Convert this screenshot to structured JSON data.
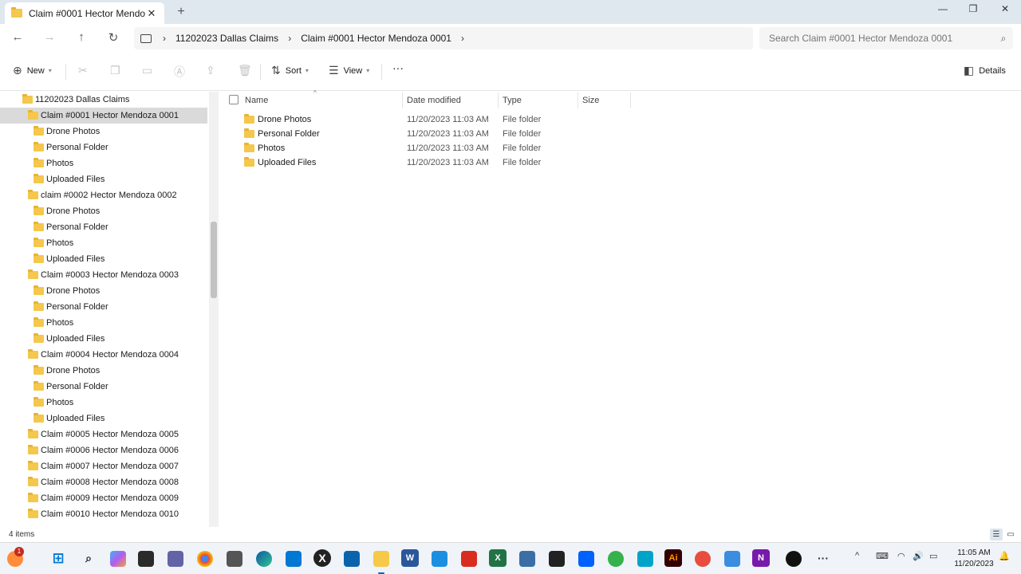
{
  "window": {
    "tab_title": "Claim #0001 Hector Mendoza 0001",
    "tab_close": "✕",
    "new_tab": "+",
    "minimize": "—",
    "maximize": "❐",
    "close": "✕"
  },
  "address": {
    "crumbs": [
      "11202023 Dallas Claims",
      "Claim #0001 Hector Mendoza 0001"
    ],
    "chevron": "›",
    "search_placeholder": "Search Claim #0001 Hector Mendoza 0001"
  },
  "toolbar": {
    "new_label": "New",
    "sort_label": "Sort",
    "view_label": "View",
    "more_label": "···",
    "details_label": "Details"
  },
  "nav_tree": {
    "root": "11202023 Dallas Claims",
    "items": [
      {
        "label": "Claim #0001 Hector Mendoza 0001",
        "level": 1,
        "selected": true
      },
      {
        "label": "Drone Photos",
        "level": 2
      },
      {
        "label": "Personal Folder",
        "level": 2
      },
      {
        "label": "Photos",
        "level": 2
      },
      {
        "label": "Uploaded Files",
        "level": 2
      },
      {
        "label": "claim #0002 Hector Mendoza 0002",
        "level": 1
      },
      {
        "label": "Drone Photos",
        "level": 2
      },
      {
        "label": "Personal Folder",
        "level": 2
      },
      {
        "label": "Photos",
        "level": 2
      },
      {
        "label": "Uploaded Files",
        "level": 2
      },
      {
        "label": "Claim #0003 Hector Mendoza 0003",
        "level": 1
      },
      {
        "label": "Drone Photos",
        "level": 2
      },
      {
        "label": "Personal Folder",
        "level": 2
      },
      {
        "label": "Photos",
        "level": 2
      },
      {
        "label": "Uploaded Files",
        "level": 2
      },
      {
        "label": "Claim #0004 Hector Mendoza 0004",
        "level": 1
      },
      {
        "label": "Drone Photos",
        "level": 2
      },
      {
        "label": "Personal Folder",
        "level": 2
      },
      {
        "label": "Photos",
        "level": 2
      },
      {
        "label": "Uploaded Files",
        "level": 2
      },
      {
        "label": "Claim #0005 Hector Mendoza 0005",
        "level": 1
      },
      {
        "label": "Claim #0006 Hector Mendoza 0006",
        "level": 1
      },
      {
        "label": "Claim #0007 Hector Mendoza 0007",
        "level": 1
      },
      {
        "label": "Claim #0008 Hector Mendoza 0008",
        "level": 1
      },
      {
        "label": "Claim #0009 Hector Mendoza 0009",
        "level": 1
      },
      {
        "label": "Claim #0010 Hector Mendoza 0010",
        "level": 1
      }
    ]
  },
  "file_list": {
    "columns": {
      "name": "Name",
      "date": "Date modified",
      "type": "Type",
      "size": "Size"
    },
    "rows": [
      {
        "name": "Drone Photos",
        "date": "11/20/2023 11:03 AM",
        "type": "File folder",
        "size": ""
      },
      {
        "name": "Personal Folder",
        "date": "11/20/2023 11:03 AM",
        "type": "File folder",
        "size": ""
      },
      {
        "name": "Photos",
        "date": "11/20/2023 11:03 AM",
        "type": "File folder",
        "size": ""
      },
      {
        "name": "Uploaded Files",
        "date": "11/20/2023 11:03 AM",
        "type": "File folder",
        "size": ""
      }
    ]
  },
  "status": {
    "item_count": "4 items"
  },
  "taskbar": {
    "notification_count": "1",
    "time": "11:05 AM",
    "date": "11/20/2023"
  },
  "colors": {
    "accent": "#0067c0",
    "folder": "#f4c74d",
    "selection": "#dadada",
    "titlebar": "#dfe7ef"
  }
}
